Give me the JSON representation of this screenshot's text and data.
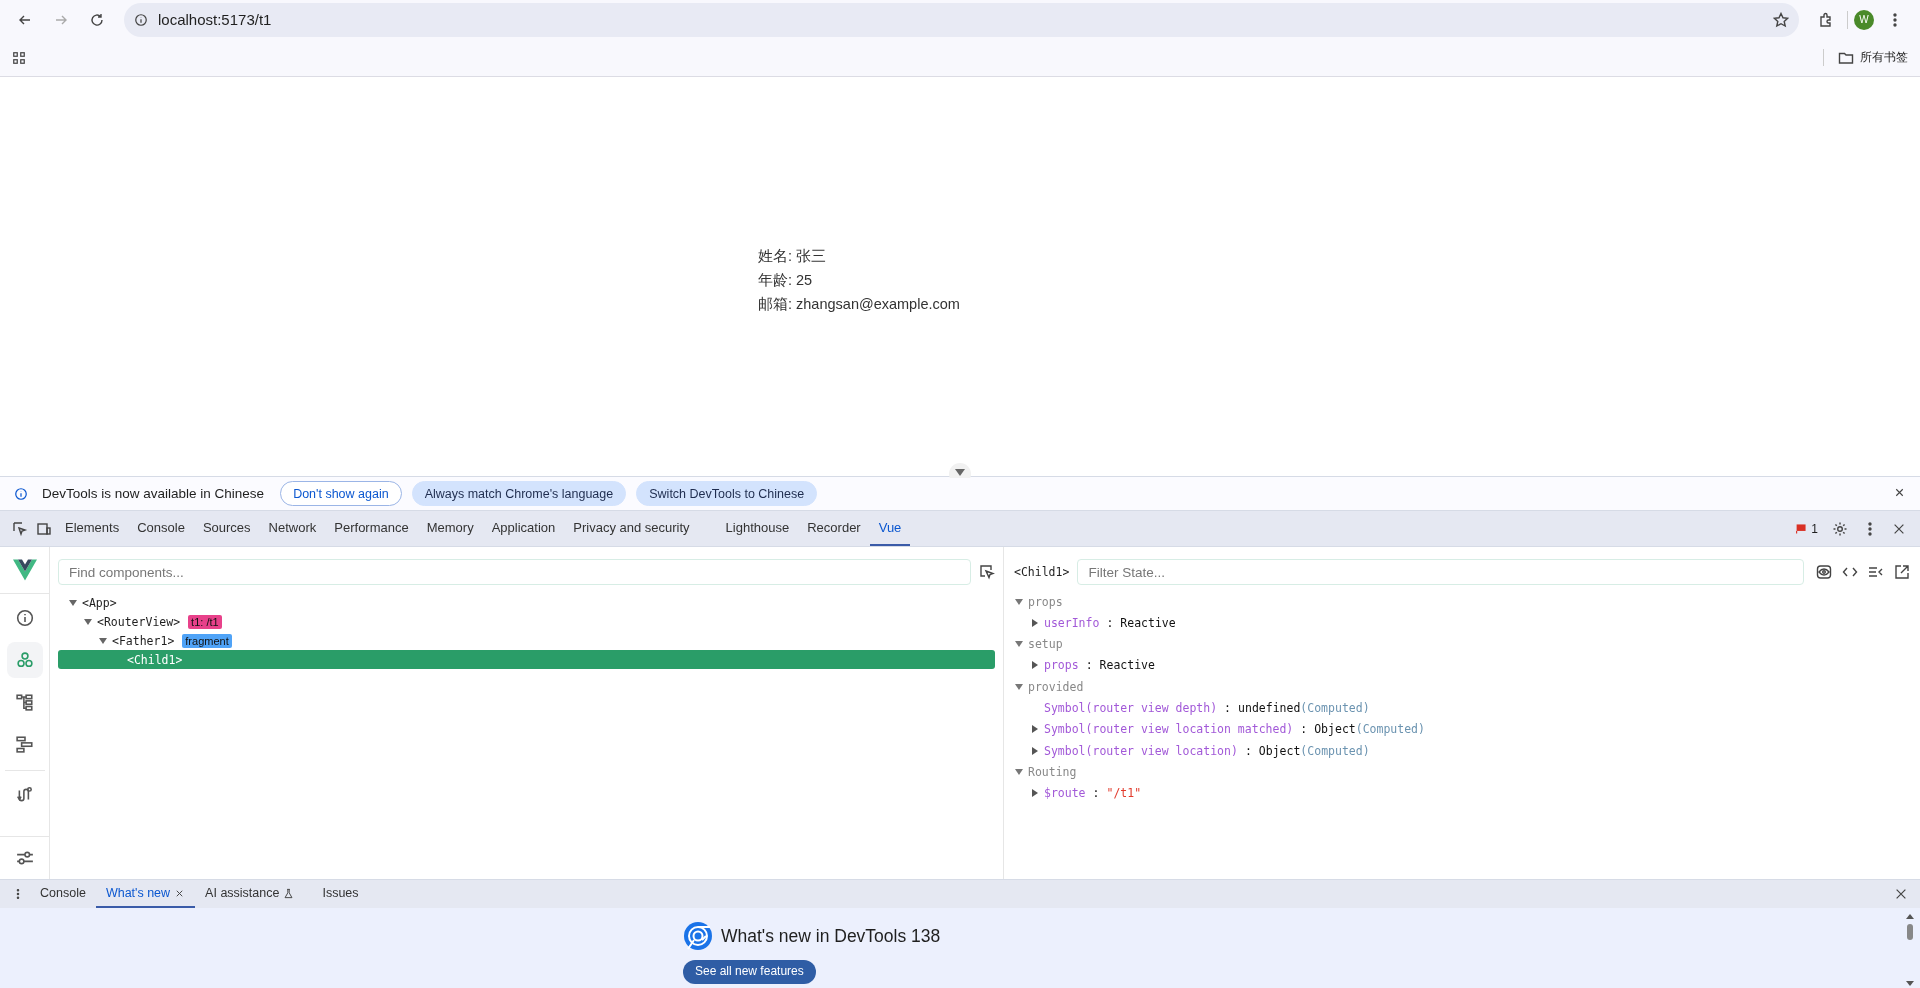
{
  "browser": {
    "url": "localhost:5173/t1",
    "avatar": "W",
    "bookmarks_folder": "所有书签"
  },
  "page": {
    "lines": [
      "姓名: 张三",
      "年龄: 25",
      "邮箱: zhangsan@example.com"
    ]
  },
  "infobar": {
    "message": "DevTools is now available in Chinese",
    "buttons": [
      {
        "label": "Don't show again",
        "kind": "outline"
      },
      {
        "label": "Always match Chrome's language",
        "kind": "filled"
      },
      {
        "label": "Switch DevTools to Chinese",
        "kind": "filled"
      }
    ]
  },
  "devtools_tabs": [
    {
      "label": "Elements",
      "selected": false
    },
    {
      "label": "Console",
      "selected": false
    },
    {
      "label": "Sources",
      "selected": false
    },
    {
      "label": "Network",
      "selected": false
    },
    {
      "label": "Performance",
      "selected": false
    },
    {
      "label": "Memory",
      "selected": false
    },
    {
      "label": "Application",
      "selected": false
    },
    {
      "label": "Privacy and security",
      "selected": false
    },
    {
      "label": "Lighthouse",
      "selected": false
    },
    {
      "label": "Recorder",
      "selected": false
    },
    {
      "label": "Vue",
      "selected": true
    }
  ],
  "issues_count": "1",
  "vue": {
    "sidebar": [
      {
        "kind": "info",
        "selected": false
      },
      {
        "kind": "components",
        "selected": true
      },
      {
        "kind": "tree",
        "selected": false
      },
      {
        "kind": "timeline",
        "selected": false
      },
      {
        "kind": "routes",
        "selected": false
      }
    ],
    "search_placeholder": "Find components...",
    "tree": [
      {
        "name": "<App>",
        "expanded": true,
        "selected": false,
        "children": [
          {
            "name": "<RouterView>",
            "expanded": true,
            "selected": false,
            "tag": {
              "text": "t1: /t1",
              "color": "#e8418a"
            },
            "children": [
              {
                "name": "<Father1>",
                "expanded": true,
                "selected": false,
                "tag": {
                  "text": "fragment",
                  "color": "#4fa3f7"
                },
                "children": [
                  {
                    "name": "<Child1>",
                    "selected": true
                  }
                ]
              }
            ]
          }
        ]
      }
    ],
    "state": {
      "component": "<Child1>",
      "filter_placeholder": "Filter State...",
      "sections": [
        {
          "title": "props",
          "expanded": true,
          "items": [
            {
              "key": "userInfo",
              "sep": ":",
              "value": "Reactive",
              "expandable": true,
              "kind": "plain"
            }
          ]
        },
        {
          "title": "setup",
          "expanded": true,
          "items": [
            {
              "key": "props",
              "sep": ":",
              "value": "Reactive",
              "expandable": true,
              "kind": "plain"
            }
          ]
        },
        {
          "title": "provided",
          "expanded": true,
          "items": [
            {
              "key": "Symbol(router view depth)",
              "sep": ":",
              "value": "undefined",
              "note": "(Computed)",
              "expandable": false,
              "kind": "plain"
            },
            {
              "key": "Symbol(router view location matched)",
              "sep": ":",
              "value": "Object",
              "note": "(Computed)",
              "expandable": true,
              "kind": "plain"
            },
            {
              "key": "Symbol(router view location)",
              "sep": ":",
              "value": "Object",
              "note": "(Computed)",
              "expandable": true,
              "kind": "plain"
            }
          ]
        },
        {
          "title": "Routing",
          "expanded": true,
          "items": [
            {
              "key": "$route",
              "sep": ":",
              "value": "\"/t1\"",
              "expandable": true,
              "kind": "string"
            }
          ]
        }
      ]
    }
  },
  "drawer": {
    "tabs": [
      {
        "label": "Console",
        "selected": false,
        "closable": false,
        "experimental": false
      },
      {
        "label": "What's new",
        "selected": true,
        "closable": true,
        "experimental": false
      },
      {
        "label": "AI assistance",
        "selected": false,
        "closable": false,
        "experimental": true
      },
      {
        "label": "Issues",
        "selected": false,
        "closable": false,
        "experimental": false
      }
    ],
    "title": "What's new in DevTools 138",
    "button": "See all new features"
  }
}
